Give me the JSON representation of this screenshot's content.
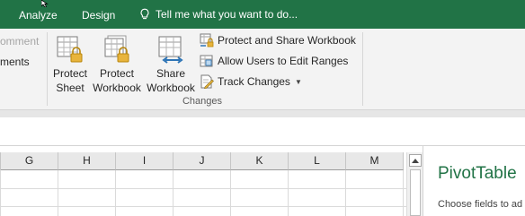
{
  "tabs": [
    {
      "label": "Analyze"
    },
    {
      "label": "Design"
    }
  ],
  "tell_me": {
    "text": "Tell me what you want to do..."
  },
  "ribbon": {
    "partial_left": [
      "omment",
      "ments"
    ],
    "group_label": "Changes",
    "big_buttons": [
      {
        "line1": "Protect",
        "line2": "Sheet",
        "icon": "protect-sheet-icon"
      },
      {
        "line1": "Protect",
        "line2": "Workbook",
        "icon": "protect-workbook-icon"
      },
      {
        "line1": "Share",
        "line2": "Workbook",
        "icon": "share-workbook-icon"
      }
    ],
    "small_buttons": [
      {
        "label": "Protect and Share Workbook",
        "icon": "protect-share-icon"
      },
      {
        "label": "Allow Users to Edit Ranges",
        "icon": "allow-edit-ranges-icon"
      },
      {
        "label": "Track Changes",
        "icon": "track-changes-icon",
        "dropdown": true
      }
    ]
  },
  "sheet": {
    "columns": [
      "G",
      "H",
      "I",
      "J",
      "K",
      "L",
      "M"
    ]
  },
  "pivot_pane": {
    "title": "PivotTable",
    "subtitle": "Choose fields to ad"
  },
  "colors": {
    "accent": "#217346",
    "ribbon_bg": "#f3f3f3",
    "header_bg": "#e8e8e8"
  }
}
